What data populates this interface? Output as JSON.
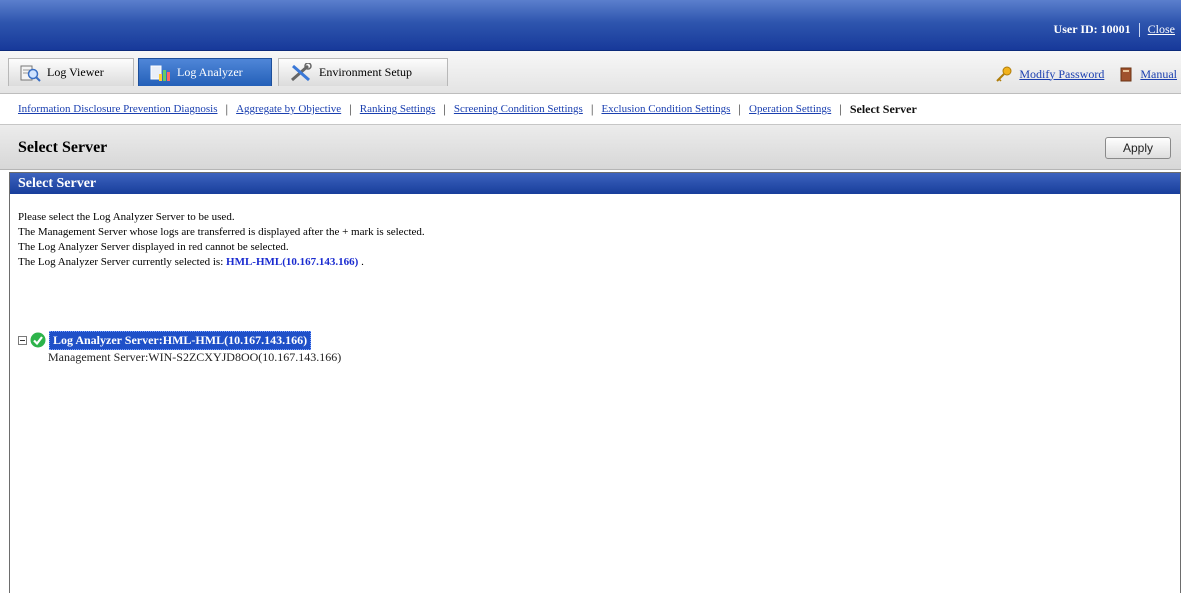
{
  "header": {
    "user_id_text": "User ID: 10001",
    "close_label": "Close"
  },
  "tabs": [
    {
      "label": "Log Viewer",
      "icon": "log-viewer-icon"
    },
    {
      "label": "Log Analyzer",
      "icon": "log-analyzer-icon",
      "active": true
    },
    {
      "label": "Environment Setup",
      "icon": "tools-icon"
    }
  ],
  "toplinks": {
    "modify_password": "Modify Password",
    "manual": "Manual"
  },
  "subnav": {
    "items": [
      "Information Disclosure Prevention Diagnosis",
      "Aggregate by Objective",
      "Ranking Settings",
      "Screening Condition Settings",
      "Exclusion Condition Settings",
      "Operation Settings"
    ],
    "current": "Select Server",
    "separator": "|"
  },
  "page": {
    "title": "Select Server",
    "apply_label": "Apply"
  },
  "panel": {
    "heading": "Select Server",
    "instructions": [
      "Please select the Log Analyzer Server to be used.",
      "The Management Server whose logs are transferred is displayed after the + mark is selected.",
      "The Log Analyzer Server displayed in red cannot be selected."
    ],
    "current_prefix": "The Log Analyzer Server currently selected is: ",
    "current_value": "HML-HML(10.167.143.166)",
    "current_suffix": " ."
  },
  "tree": {
    "root_label": "Log Analyzer Server:HML-HML(10.167.143.166)",
    "child_label": "Management Server:WIN-S2ZCXYJD8OO(10.167.143.166)"
  },
  "colors": {
    "header_blue": "#2e55ae",
    "link": "#1a3fb0",
    "selection": "#1f50c8",
    "selected_server_text": "#1a2bd0"
  }
}
